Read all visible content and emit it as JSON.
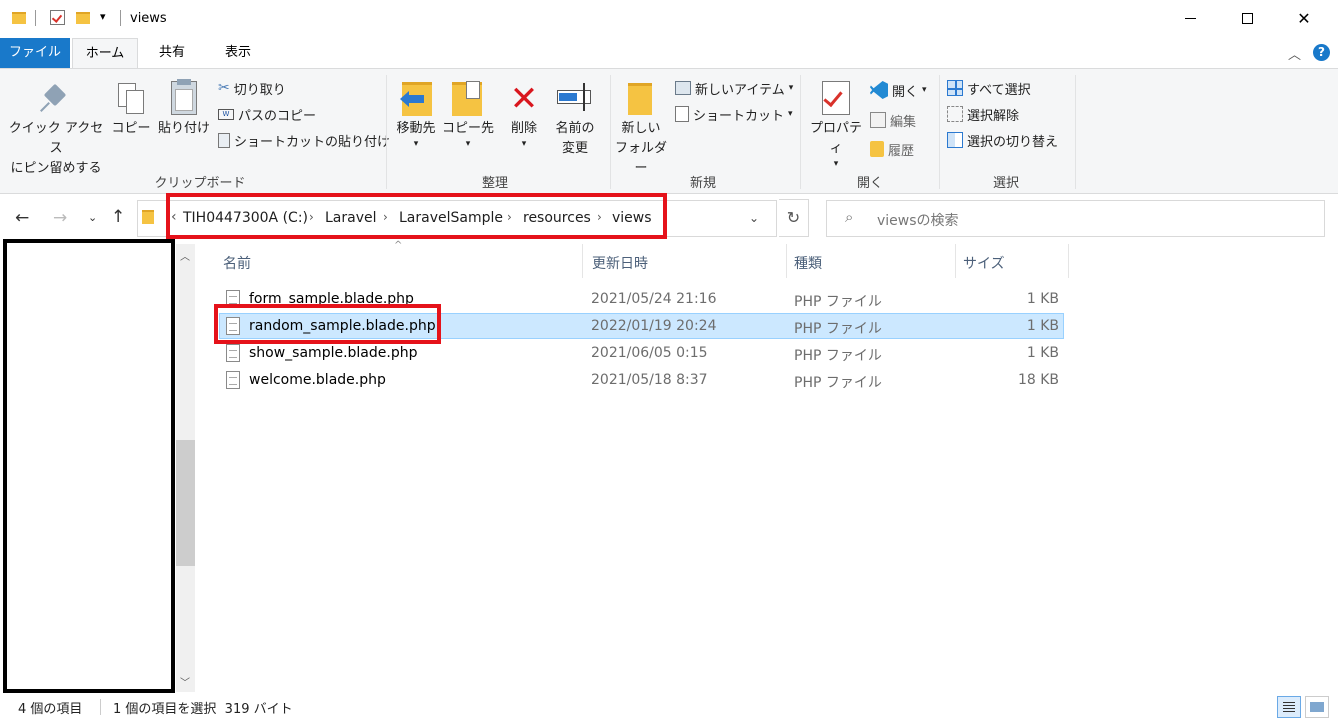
{
  "window": {
    "title": "views"
  },
  "tabs": {
    "file": "ファイル",
    "home": "ホーム",
    "share": "共有",
    "view": "表示"
  },
  "ribbon": {
    "clipboard": {
      "label": "クリップボード",
      "pin_line1": "クイック アクセス",
      "pin_line2": "にピン留めする",
      "copy": "コピー",
      "paste": "貼り付け",
      "cut": "切り取り",
      "copy_path": "パスのコピー",
      "paste_shortcut": "ショートカットの貼り付け"
    },
    "organize": {
      "label": "整理",
      "move_to": "移動先",
      "copy_to": "コピー先",
      "delete": "削除",
      "rename_line1": "名前の",
      "rename_line2": "変更"
    },
    "new": {
      "label": "新規",
      "new_folder_line1": "新しい",
      "new_folder_line2": "フォルダー",
      "new_item": "新しいアイテム",
      "shortcut": "ショートカット"
    },
    "open": {
      "label": "開く",
      "properties": "プロパティ",
      "open": "開く",
      "edit": "編集",
      "history": "履歴"
    },
    "select": {
      "label": "選択",
      "select_all": "すべて選択",
      "select_none": "選択解除",
      "invert": "選択の切り替え"
    }
  },
  "address": {
    "crumbs": [
      "TIH0447300A (C:)",
      "Laravel",
      "LaravelSample",
      "resources",
      "views"
    ],
    "overflow": "‹",
    "search_placeholder": "viewsの検索"
  },
  "columns": {
    "name": "名前",
    "date": "更新日時",
    "type": "種類",
    "size": "サイズ"
  },
  "files": [
    {
      "name": "form_sample.blade.php",
      "date": "2021/05/24 21:16",
      "type": "PHP ファイル",
      "size": "1 KB"
    },
    {
      "name": "random_sample.blade.php",
      "date": "2022/01/19 20:24",
      "type": "PHP ファイル",
      "size": "1 KB"
    },
    {
      "name": "show_sample.blade.php",
      "date": "2021/06/05 0:15",
      "type": "PHP ファイル",
      "size": "1 KB"
    },
    {
      "name": "welcome.blade.php",
      "date": "2021/05/18 8:37",
      "type": "PHP ファイル",
      "size": "18 KB"
    }
  ],
  "status": {
    "count": "4 個の項目",
    "selection": "1 個の項目を選択  319 バイト"
  },
  "colors": {
    "accent": "#1979ca",
    "highlight": "#e5121a",
    "selection": "#cce8ff"
  }
}
